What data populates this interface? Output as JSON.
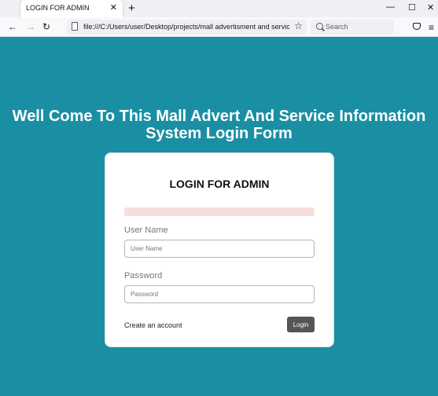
{
  "browser": {
    "tab_title": "LOGIN FOR ADMIN",
    "tab_close": "✕",
    "new_tab": "+",
    "minimize": "—",
    "maximize": "☐",
    "close": "✕",
    "back": "←",
    "forward": "→",
    "reload": "↻",
    "url": "file:///C:/Users/user/Desktop/projects/mall advertisment and service inform",
    "bookmark": "☆",
    "search_placeholder": "Search",
    "menu": "≡"
  },
  "page": {
    "heading_line1": "Well Come To This Mall Advert And Service Information",
    "heading_line2": "System Login Form",
    "background_color": "#1a8fa3"
  },
  "form": {
    "title": "LOGIN FOR ADMIN",
    "username_label": "User Name",
    "username_placeholder": "User Name",
    "username_value": "",
    "password_label": "Password",
    "password_placeholder": "Password",
    "password_value": "",
    "create_account": "Create an account",
    "login_button": "Login"
  }
}
